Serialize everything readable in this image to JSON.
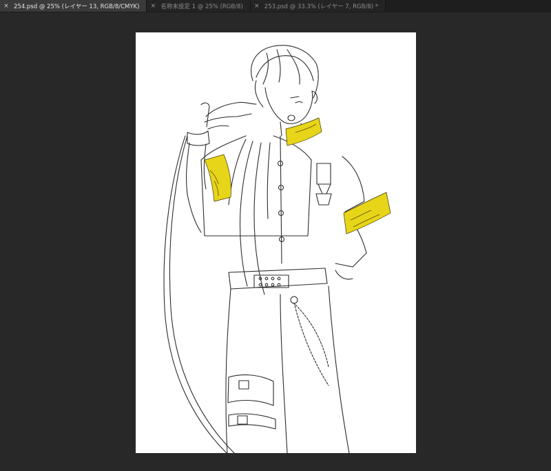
{
  "tabs": [
    {
      "label": "254.psd @ 25% (レイヤー 13, RGB/8/CMYK)",
      "active": true
    },
    {
      "label": "名称未設定 1 @ 25% (RGB/8)",
      "active": false
    },
    {
      "label": "253.psd @ 33.3% (レイヤー 7, RGB/8) *",
      "active": false
    }
  ],
  "icons": {
    "tab_close": "×"
  },
  "colors": {
    "workspace": "#282828",
    "tabbar": "#1e1e1e",
    "accent_gold": "#e7d51a",
    "line": "#2a2a2a"
  }
}
